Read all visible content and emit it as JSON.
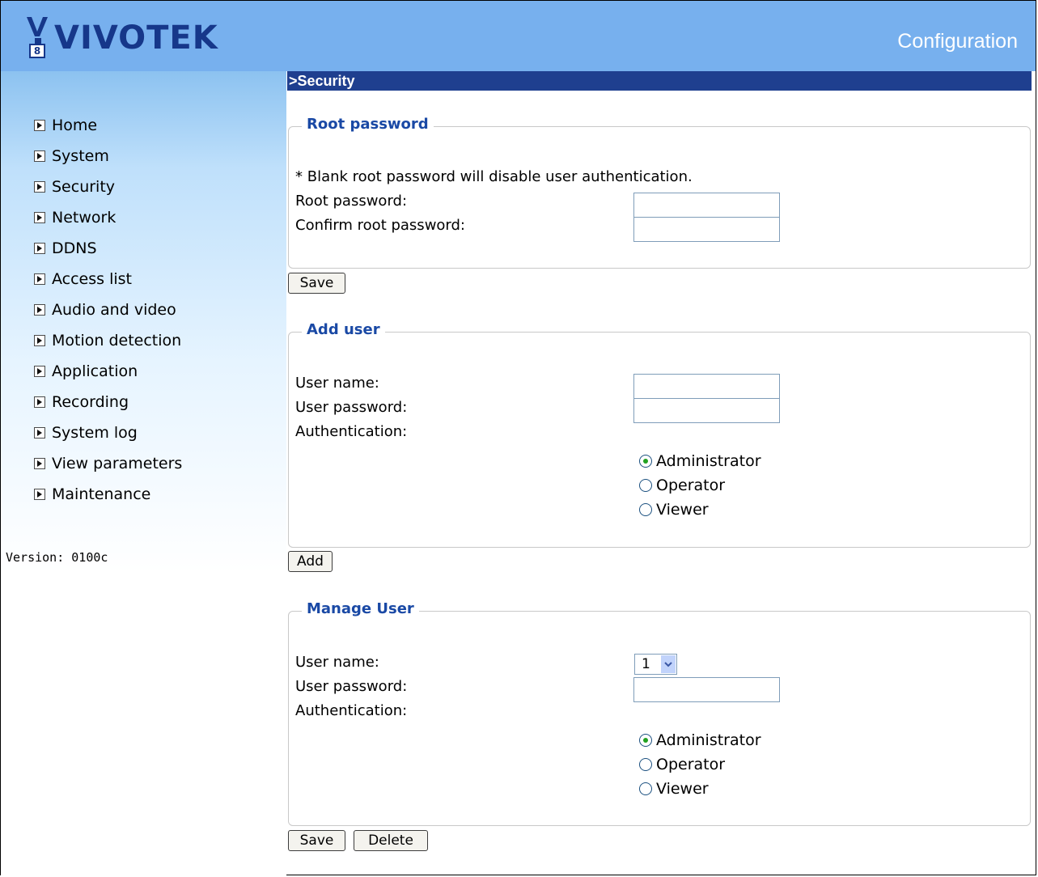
{
  "header": {
    "brand": "VIVOTEK",
    "title": "Configuration"
  },
  "sidebar": {
    "items": [
      {
        "label": "Home"
      },
      {
        "label": "System"
      },
      {
        "label": "Security"
      },
      {
        "label": "Network"
      },
      {
        "label": "DDNS"
      },
      {
        "label": "Access list"
      },
      {
        "label": "Audio and video"
      },
      {
        "label": "Motion detection"
      },
      {
        "label": "Application"
      },
      {
        "label": "Recording"
      },
      {
        "label": "System log"
      },
      {
        "label": "View parameters"
      },
      {
        "label": "Maintenance"
      }
    ],
    "version": "Version: 0100c"
  },
  "page": {
    "section_title": ">Security"
  },
  "root_password": {
    "legend": "Root password",
    "note": "* Blank root password will disable user authentication.",
    "root_password_label": "Root password:",
    "confirm_label": "Confirm root password:",
    "root_password_value": "",
    "confirm_value": "",
    "save_label": "Save"
  },
  "add_user": {
    "legend": "Add user",
    "user_name_label": "User name:",
    "user_password_label": "User password:",
    "authentication_label": "Authentication:",
    "user_name_value": "",
    "user_password_value": "",
    "auth_options": [
      "Administrator",
      "Operator",
      "Viewer"
    ],
    "selected": "Administrator",
    "add_label": "Add"
  },
  "manage_user": {
    "legend": "Manage User",
    "user_name_label": "User name:",
    "user_password_label": "User password:",
    "authentication_label": "Authentication:",
    "selected_user": "1",
    "user_password_value": "",
    "auth_options": [
      "Administrator",
      "Operator",
      "Viewer"
    ],
    "selected": "Administrator",
    "save_label": "Save",
    "delete_label": "Delete"
  },
  "icons": {
    "nav_bullet": "arrow-right-icon",
    "select_arrow": "chevron-down-icon",
    "logo": "vivotek-logo-icon"
  },
  "colors": {
    "header_bg": "#77b0ee",
    "section_bar": "#1f3f8f",
    "legend_text": "#1a49a5"
  }
}
